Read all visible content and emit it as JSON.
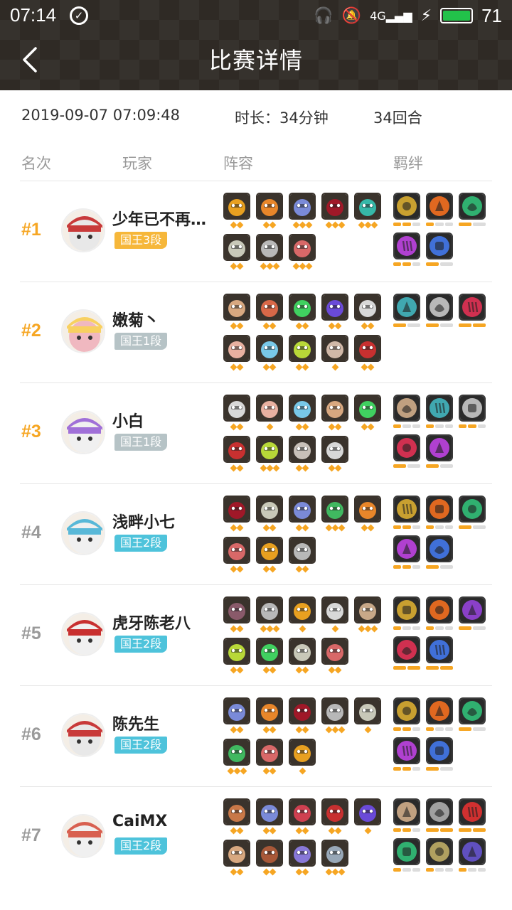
{
  "status": {
    "time": "07:14",
    "battery": "71",
    "signal": "4G"
  },
  "header": {
    "title": "比赛详情"
  },
  "info": {
    "datetime": "2019-09-07 07:09:48",
    "duration": "时长：34分钟",
    "rounds": "34回合"
  },
  "columns": {
    "rank": "名次",
    "player": "玩家",
    "lineup": "阵容",
    "bonds": "羁绊"
  },
  "colors": {
    "gold": "#f6a623",
    "rank_gray": "#9a9a9a",
    "badge_gold": "#f6b73a",
    "badge_gray": "#b6c3c6",
    "badge_blue": "#4ec3db"
  },
  "players": [
    {
      "rank": "#1",
      "name": "少年已不再…",
      "badge": "国王3段",
      "badge_style": "gold",
      "avatar": [
        "#c83a3a",
        "#e8e8e8"
      ],
      "units": [
        [
          "#e8a020",
          2
        ],
        [
          "#e8862a",
          2
        ],
        [
          "#7a8ad8",
          3
        ],
        [
          "#a01828",
          3
        ],
        [
          "#36b8a8",
          3
        ],
        [
          "#c8c8b8",
          2
        ],
        [
          "#b8b8b8",
          3
        ],
        [
          "#d86868",
          3
        ]
      ],
      "bonds": [
        [
          "#c8a030",
          4
        ],
        [
          "#e06820",
          3
        ],
        [
          "#30b070",
          2
        ],
        [
          "#b040d0",
          4
        ],
        [
          "#4070d8",
          2
        ]
      ],
      "bond_levels": [
        2,
        1,
        1,
        2,
        1
      ]
    },
    {
      "rank": "#2",
      "name": "嫩菊丶",
      "badge": "国王1段",
      "badge_style": "gray",
      "avatar": [
        "#f8d060",
        "#f0b8c0"
      ],
      "units": [
        [
          "#d8a880",
          2
        ],
        [
          "#d86848",
          2
        ],
        [
          "#40d060",
          2
        ],
        [
          "#6a4ad8",
          2
        ],
        [
          "#d8d8d8",
          2
        ],
        [
          "#e8b0a0",
          2
        ],
        [
          "#78c8e8",
          2
        ],
        [
          "#b8d838",
          2
        ],
        [
          "#d0b8a8",
          1
        ],
        [
          "#c83030",
          2
        ]
      ],
      "bonds": [
        [
          "#40a8b0",
          2
        ],
        [
          "#b8b8b8",
          2
        ],
        [
          "#d03050",
          2
        ]
      ],
      "bond_levels": [
        1,
        1,
        2
      ]
    },
    {
      "rank": "#3",
      "name": "小白",
      "badge": "国王1段",
      "badge_style": "gray",
      "avatar": [
        "#a070d8",
        "#f0f0f0"
      ],
      "units": [
        [
          "#d8d8d8",
          2
        ],
        [
          "#e8b0a0",
          1
        ],
        [
          "#78c8e8",
          2
        ],
        [
          "#d8a880",
          2
        ],
        [
          "#40d060",
          2
        ],
        [
          "#c83030",
          2
        ],
        [
          "#b8d838",
          3
        ],
        [
          "#c8c0b8",
          2
        ],
        [
          "#d8d8d8",
          2
        ]
      ],
      "bonds": [
        [
          "#c0a080",
          4
        ],
        [
          "#40a8b0",
          4
        ],
        [
          "#b8b8b8",
          4
        ],
        [
          "#d03050",
          2
        ],
        [
          "#b040d0",
          2
        ]
      ],
      "bond_levels": [
        1,
        1,
        2,
        1,
        1
      ]
    },
    {
      "rank": "#4",
      "name": "浅畔小七",
      "badge": "国王2段",
      "badge_style": "blue",
      "avatar": [
        "#58b8d8",
        "#f0f0f0"
      ],
      "units": [
        [
          "#a01828",
          2
        ],
        [
          "#c8c8b8",
          2
        ],
        [
          "#7a8ad8",
          2
        ],
        [
          "#40b860",
          3
        ],
        [
          "#e8862a",
          2
        ],
        [
          "#d86868",
          2
        ],
        [
          "#e8a020",
          2
        ],
        [
          "#b8b8b8",
          2
        ]
      ],
      "bonds": [
        [
          "#c8a030",
          4
        ],
        [
          "#e06820",
          3
        ],
        [
          "#30b070",
          2
        ],
        [
          "#b040d0",
          4
        ],
        [
          "#4070d8",
          2
        ]
      ],
      "bond_levels": [
        2,
        1,
        1,
        2,
        1
      ]
    },
    {
      "rank": "#5",
      "name": "虎牙陈老八",
      "badge": "国王2段",
      "badge_style": "blue",
      "avatar": [
        "#c83030",
        "#f0f0f0"
      ],
      "units": [
        [
          "#8a5a6a",
          2
        ],
        [
          "#b8b8b8",
          3
        ],
        [
          "#e8a020",
          1
        ],
        [
          "#d8d8d8",
          1
        ],
        [
          "#c8a888",
          3
        ],
        [
          "#b8d838",
          2
        ],
        [
          "#40d060",
          2
        ],
        [
          "#c8c8b8",
          2
        ],
        [
          "#d86868",
          2
        ]
      ],
      "bonds": [
        [
          "#c8a030",
          4
        ],
        [
          "#e06820",
          3
        ],
        [
          "#8a40c8",
          2
        ],
        [
          "#d03050",
          2
        ],
        [
          "#4070d8",
          2
        ]
      ],
      "bond_levels": [
        1,
        1,
        1,
        2,
        2
      ]
    },
    {
      "rank": "#6",
      "name": "陈先生",
      "badge": "国王2段",
      "badge_style": "blue",
      "avatar": [
        "#c83a3a",
        "#e8e8e8"
      ],
      "units": [
        [
          "#7a8ad8",
          2
        ],
        [
          "#e8862a",
          2
        ],
        [
          "#a01828",
          2
        ],
        [
          "#b8b8b8",
          3
        ],
        [
          "#c8c8b8",
          1
        ],
        [
          "#40b860",
          3
        ],
        [
          "#d86868",
          2
        ],
        [
          "#e8a020",
          1
        ]
      ],
      "bonds": [
        [
          "#c8a030",
          4
        ],
        [
          "#e06820",
          3
        ],
        [
          "#30b070",
          2
        ],
        [
          "#b040d0",
          4
        ],
        [
          "#4070d8",
          2
        ]
      ],
      "bond_levels": [
        2,
        1,
        1,
        2,
        1
      ]
    },
    {
      "rank": "#7",
      "name": "CaiMX",
      "badge": "国王2段",
      "badge_style": "blue",
      "avatar": [
        "#d86050",
        "#f0f0f0"
      ],
      "units": [
        [
          "#c87848",
          2
        ],
        [
          "#7a8ad8",
          2
        ],
        [
          "#d04050",
          2
        ],
        [
          "#c83030",
          2
        ],
        [
          "#6a4ad8",
          1
        ],
        [
          "#d8a880",
          2
        ],
        [
          "#a85838",
          2
        ],
        [
          "#8878d8",
          2
        ],
        [
          "#98a8b8",
          3
        ]
      ],
      "bonds": [
        [
          "#c0a080",
          4
        ],
        [
          "#a0a0a0",
          2
        ],
        [
          "#d03030",
          2
        ],
        [
          "#30b070",
          4
        ],
        [
          "#b0a060",
          4
        ],
        [
          "#6050c0",
          4
        ]
      ],
      "bond_levels": [
        2,
        2,
        2,
        1,
        1,
        1
      ]
    }
  ]
}
